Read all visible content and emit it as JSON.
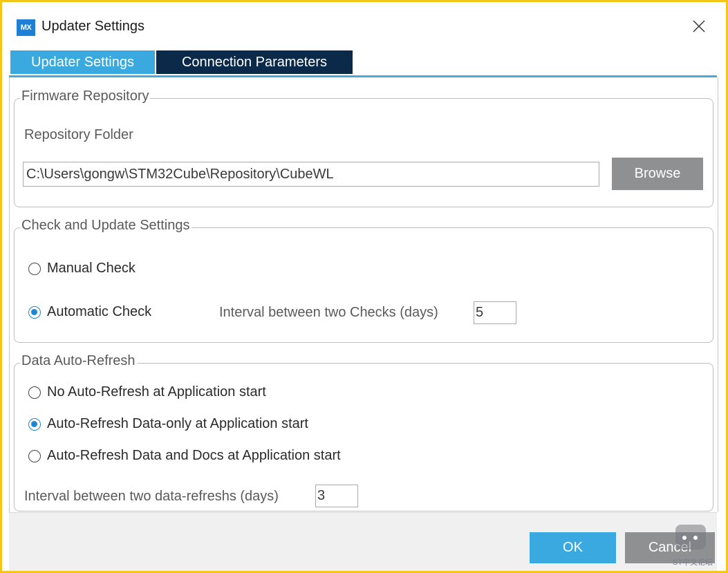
{
  "window": {
    "app_icon_text": "MX",
    "title": "Updater Settings"
  },
  "tabs": [
    {
      "label": "Updater Settings",
      "active": true
    },
    {
      "label": "Connection Parameters",
      "active": false
    }
  ],
  "firmware_repository": {
    "legend": "Firmware Repository",
    "folder_label": "Repository Folder",
    "folder_value": "C:\\Users\\gongw\\STM32Cube\\Repository\\CubeWL",
    "browse_label": "Browse"
  },
  "check_update": {
    "legend": "Check and Update Settings",
    "options": [
      {
        "label": "Manual Check",
        "selected": false
      },
      {
        "label": "Automatic Check",
        "selected": true
      }
    ],
    "interval_label": "Interval between two Checks (days)",
    "interval_value": "5"
  },
  "data_refresh": {
    "legend": "Data Auto-Refresh",
    "options": [
      {
        "label": "No Auto-Refresh at Application start",
        "selected": false
      },
      {
        "label": "Auto-Refresh Data-only at Application start",
        "selected": true
      },
      {
        "label": "Auto-Refresh Data and Docs at Application start",
        "selected": false
      }
    ],
    "interval_label": "Interval between two data-refreshs (days)",
    "interval_value": "3"
  },
  "footer": {
    "ok_label": "OK",
    "cancel_label": "Cancel"
  },
  "watermark": {
    "text": "ST中文论坛"
  },
  "colors": {
    "accent": "#39a9df",
    "tab_inactive": "#0b2a4a",
    "button_gray": "#8f9092",
    "frame_highlight": "#f5c518"
  }
}
